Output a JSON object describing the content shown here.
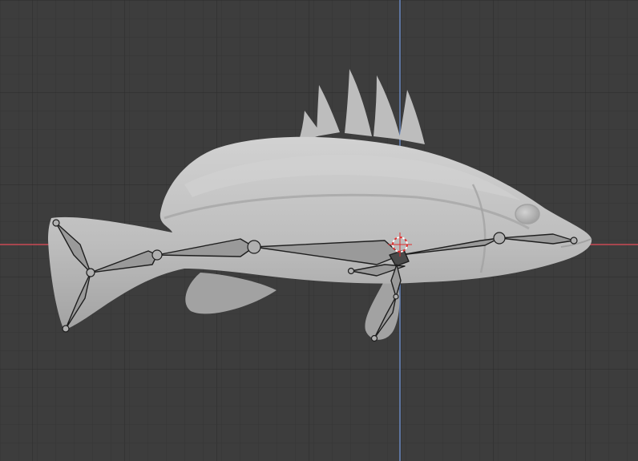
{
  "viewport": {
    "name": "3D Viewport",
    "background_color": "#3d3d3d",
    "grid_minor_color": "#353535",
    "grid_major_color": "#2e2e2e",
    "x_axis_color": "#c94a55",
    "y_axis_color": "#6b8cc7"
  },
  "model": {
    "name": "fish-mesh",
    "body_color": "#bdbdbd",
    "shade_color": "#a2a2a2",
    "highlight_color": "#d2d2d2"
  },
  "armature": {
    "name": "fish-armature",
    "bone_fill": "#9a9a9a",
    "bone_stroke": "#1e1e1e",
    "joint_fill": "#b0b0b0"
  },
  "cursor": {
    "name": "3d-cursor",
    "ring_color": "#e03030",
    "ring_alt_color": "#ffffff"
  }
}
